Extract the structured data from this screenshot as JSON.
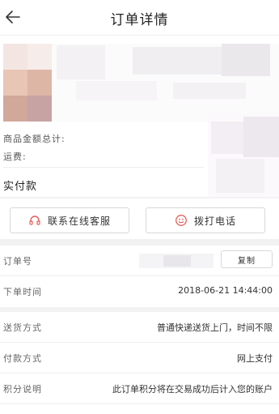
{
  "header": {
    "title": "订单详情",
    "back_icon": "back-arrow-icon"
  },
  "summary": {
    "goods_total_label": "商品金额总计:",
    "shipping_label": "运费:",
    "actual_paid_label": "实付款"
  },
  "actions": {
    "service_label": "联系在线客服",
    "phone_label": "拨打电话"
  },
  "order": {
    "number_label": "订单号",
    "copy_label": "复制",
    "time_label": "下单时间",
    "time_value": "2018-06-21 14:44:00"
  },
  "details": {
    "delivery_label": "送货方式",
    "delivery_value": "普通快递送货上门，时间不限",
    "payment_label": "付款方式",
    "payment_value": "网上支付",
    "points_label": "积分说明",
    "points_value": "此订单积分将在交易成功后计入您的账户"
  }
}
